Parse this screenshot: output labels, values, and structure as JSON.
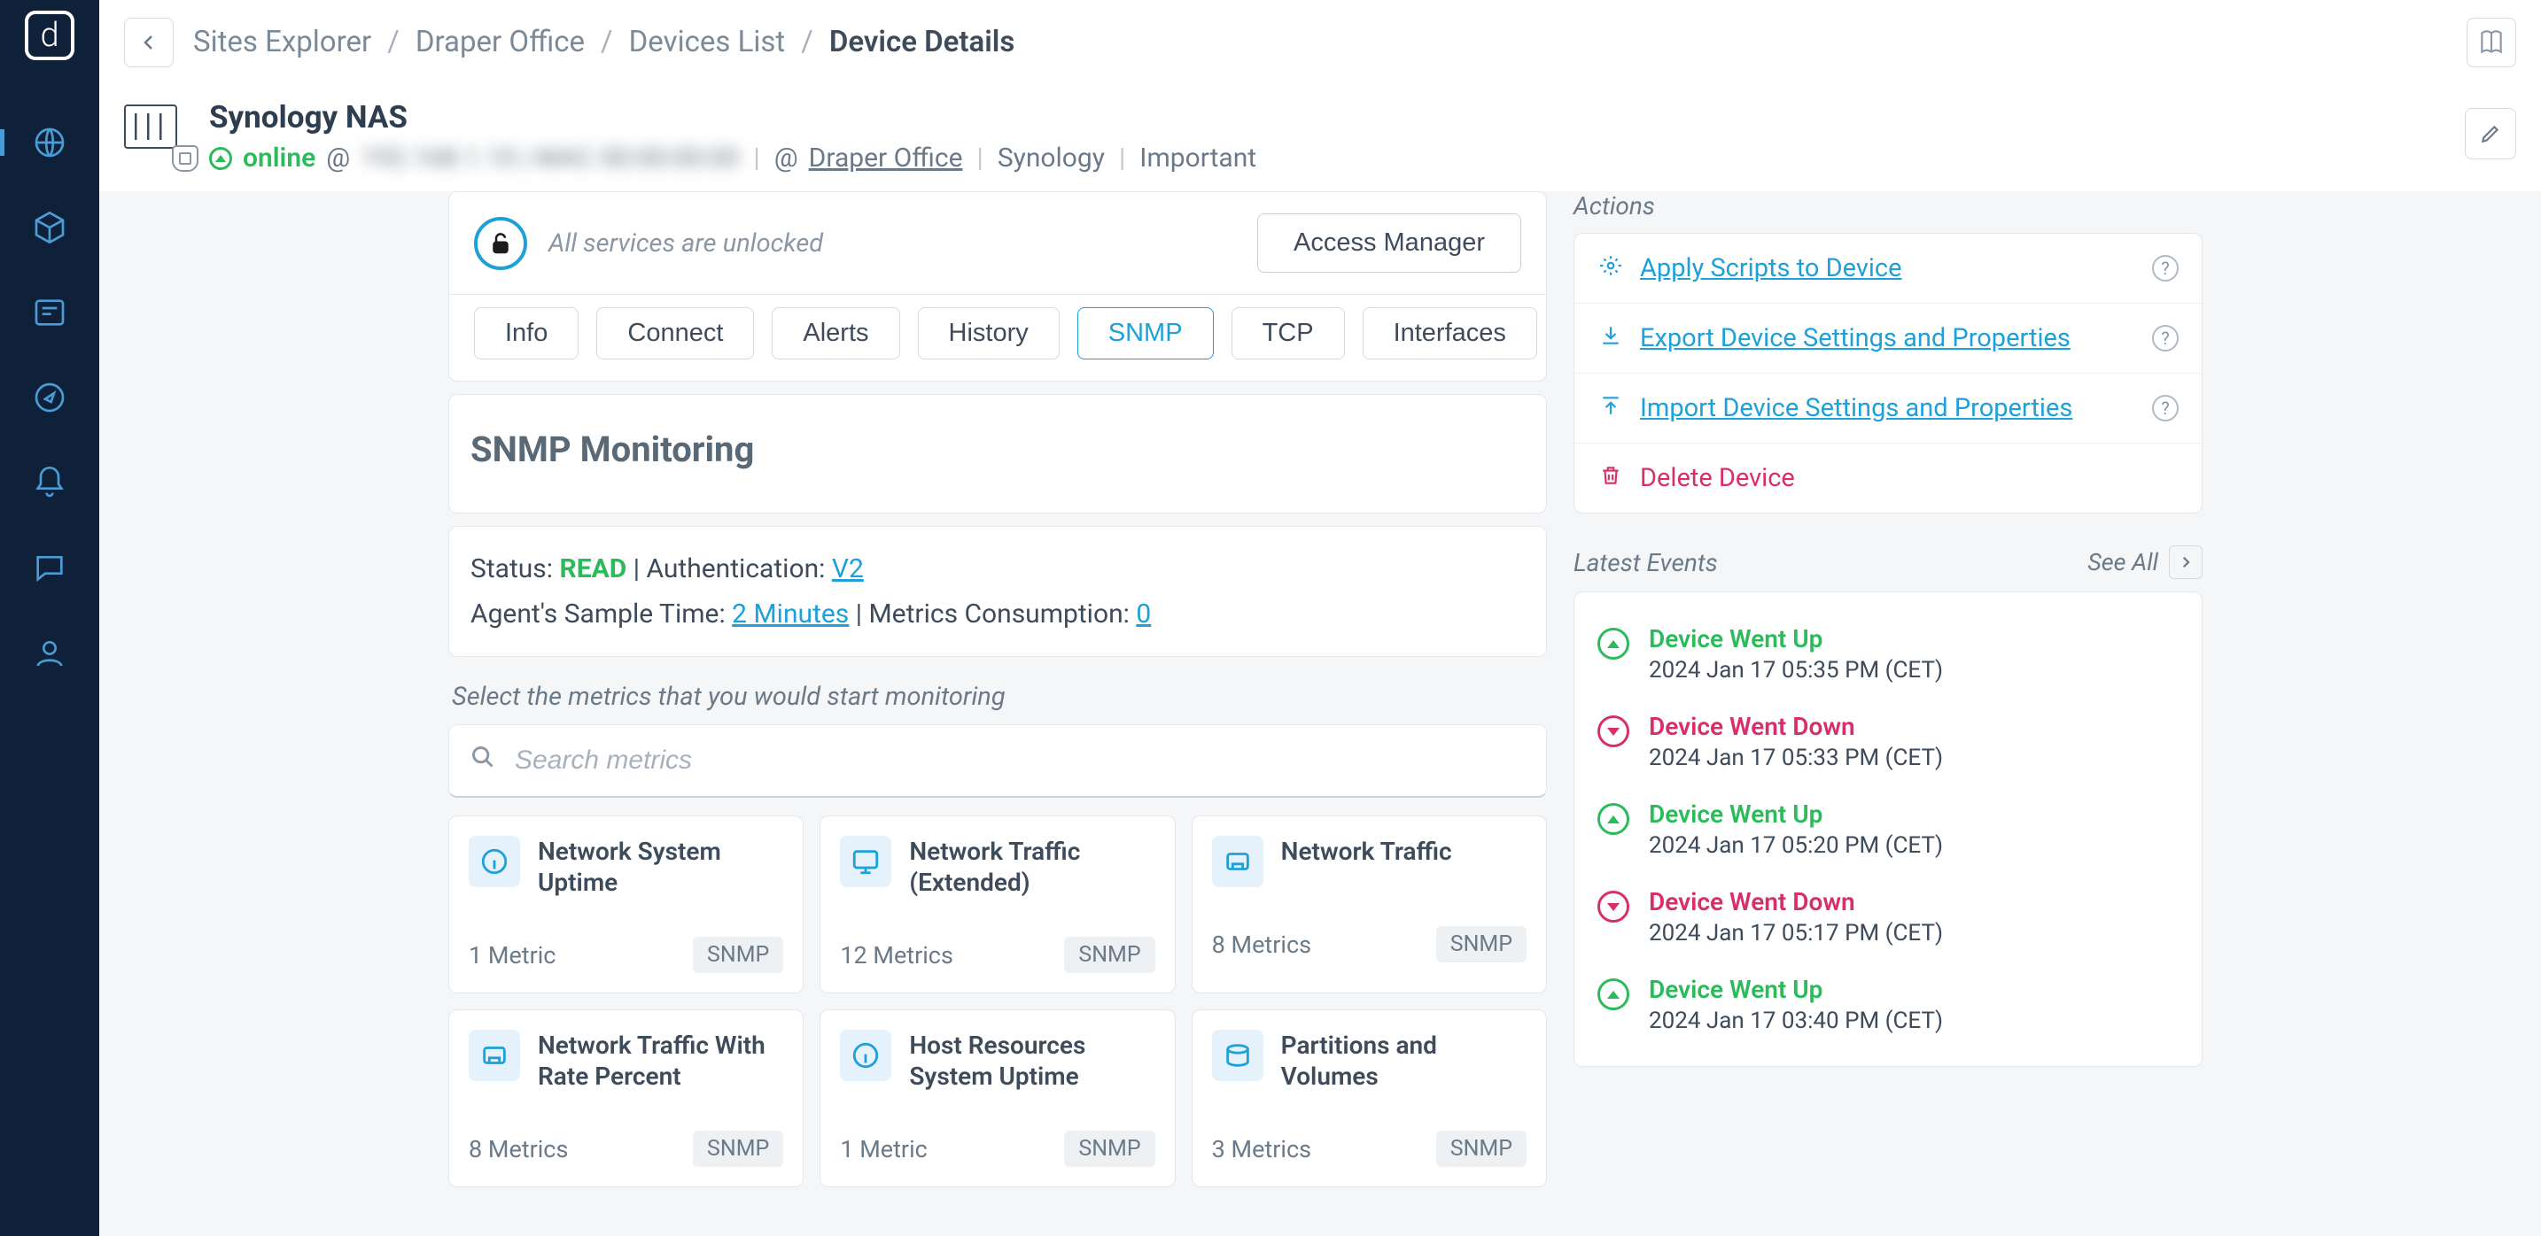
{
  "breadcrumbs": {
    "items": [
      "Sites Explorer",
      "Draper Office",
      "Devices List",
      "Device Details"
    ]
  },
  "device": {
    "name": "Synology NAS",
    "status": "online",
    "at": "@",
    "redacted": "192.168.1.10   |   MAC 00:00:00:00",
    "site_prefix": "@",
    "site": "Draper Office",
    "vendor": "Synology",
    "importance": "Important"
  },
  "unlock": {
    "text": "All services are unlocked",
    "button": "Access Manager"
  },
  "tabs": [
    "Info",
    "Connect",
    "Alerts",
    "History",
    "SNMP",
    "TCP",
    "Interfaces"
  ],
  "active_tab": 4,
  "snmp": {
    "title": "SNMP Monitoring",
    "status_label": "Status: ",
    "status_value": "READ",
    "auth_label": " | Authentication: ",
    "auth_value": "V2",
    "sample_label": "Agent's Sample Time: ",
    "sample_value": "2 Minutes",
    "consumption_label": " | Metrics Consumption: ",
    "consumption_value": "0",
    "hint": "Select the metrics that you would start monitoring",
    "search_placeholder": "Search metrics"
  },
  "metrics": [
    {
      "icon": "info",
      "title": "Network System Uptime",
      "count": "1 Metric",
      "proto": "SNMP"
    },
    {
      "icon": "monitor",
      "title": "Network Traffic (Extended)",
      "count": "12 Metrics",
      "proto": "SNMP"
    },
    {
      "icon": "nic",
      "title": "Network Traffic",
      "count": "8 Metrics",
      "proto": "SNMP"
    },
    {
      "icon": "nic",
      "title": "Network Traffic With Rate Percent",
      "count": "8 Metrics",
      "proto": "SNMP"
    },
    {
      "icon": "info",
      "title": "Host Resources System Uptime",
      "count": "1 Metric",
      "proto": "SNMP"
    },
    {
      "icon": "disk",
      "title": "Partitions and Volumes",
      "count": "3 Metrics",
      "proto": "SNMP"
    }
  ],
  "actions": {
    "label": "Actions",
    "items": [
      {
        "icon": "gear",
        "text": "Apply Scripts to Device",
        "help": true
      },
      {
        "icon": "download",
        "text": "Export Device Settings and Properties",
        "help": true
      },
      {
        "icon": "upload",
        "text": "Import Device Settings and Properties",
        "help": true
      },
      {
        "icon": "trash",
        "text": "Delete Device",
        "help": false,
        "danger": true
      }
    ]
  },
  "events": {
    "label": "Latest Events",
    "see_all": "See All",
    "items": [
      {
        "type": "up",
        "title": "Device Went Up",
        "time": "2024 Jan 17 05:35 PM (CET)"
      },
      {
        "type": "down",
        "title": "Device Went Down",
        "time": "2024 Jan 17 05:33 PM (CET)"
      },
      {
        "type": "up",
        "title": "Device Went Up",
        "time": "2024 Jan 17 05:20 PM (CET)"
      },
      {
        "type": "down",
        "title": "Device Went Down",
        "time": "2024 Jan 17 05:17 PM (CET)"
      },
      {
        "type": "up",
        "title": "Device Went Up",
        "time": "2024 Jan 17 03:40 PM (CET)"
      }
    ]
  }
}
